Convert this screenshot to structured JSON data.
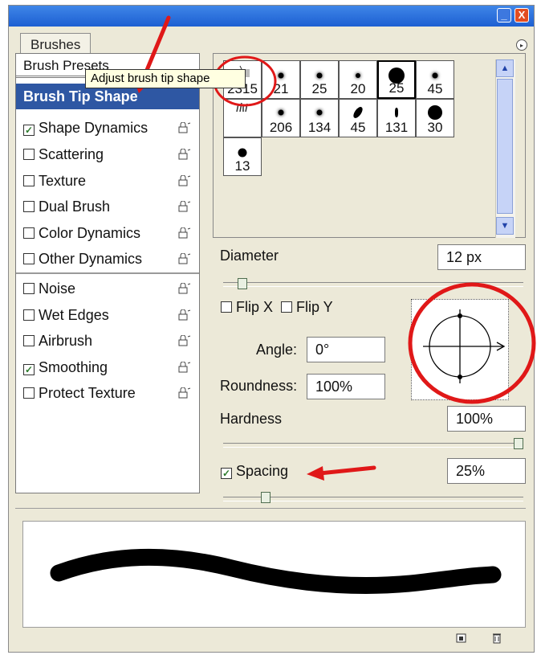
{
  "window": {
    "minimize_label": "_",
    "close_label": "X",
    "tab_label": "Brushes",
    "menu_label": "▸"
  },
  "left_panel": {
    "presets_label": "Brush Presets",
    "selected_label": "Brush Tip Shape",
    "options": [
      {
        "label": "Shape Dynamics",
        "checked": true,
        "locked": true
      },
      {
        "label": "Scattering",
        "checked": false,
        "locked": true
      },
      {
        "label": "Texture",
        "checked": false,
        "locked": true
      },
      {
        "label": "Dual Brush",
        "checked": false,
        "locked": true
      },
      {
        "label": "Color Dynamics",
        "checked": false,
        "locked": true
      },
      {
        "label": "Other Dynamics",
        "checked": false,
        "locked": true
      },
      {
        "label": "Noise",
        "checked": false,
        "locked": true
      },
      {
        "label": "Wet Edges",
        "checked": false,
        "locked": true
      },
      {
        "label": "Airbrush",
        "checked": false,
        "locked": true
      },
      {
        "label": "Smoothing",
        "checked": true,
        "locked": true
      },
      {
        "label": "Protect Texture",
        "checked": false,
        "locked": true
      }
    ],
    "tooltip": "Adjust brush tip shape"
  },
  "brush_grid": {
    "row1": [
      "2315",
      "21",
      "25",
      "20",
      "25",
      "45"
    ],
    "row2": [
      "",
      "206",
      "134",
      "45",
      "131",
      "30"
    ],
    "row3": [
      "13"
    ]
  },
  "tip_settings": {
    "diameter_label": "Diameter",
    "diameter_value": "12 px",
    "diameter_slider": 0.05,
    "flip_x_label": "Flip X",
    "flip_y_label": "Flip Y",
    "angle_label": "Angle:",
    "angle_value": "0°",
    "roundness_label": "Roundness:",
    "roundness_value": "100%",
    "hardness_label": "Hardness",
    "hardness_value": "100%",
    "hardness_slider": 1.0,
    "spacing_label": "Spacing",
    "spacing_checked": true,
    "spacing_value": "25%",
    "spacing_slider": 0.13
  },
  "colors": {
    "selection": "#2e57a3",
    "annotation": "#e01818",
    "checkmark": "#2a7a2a"
  }
}
